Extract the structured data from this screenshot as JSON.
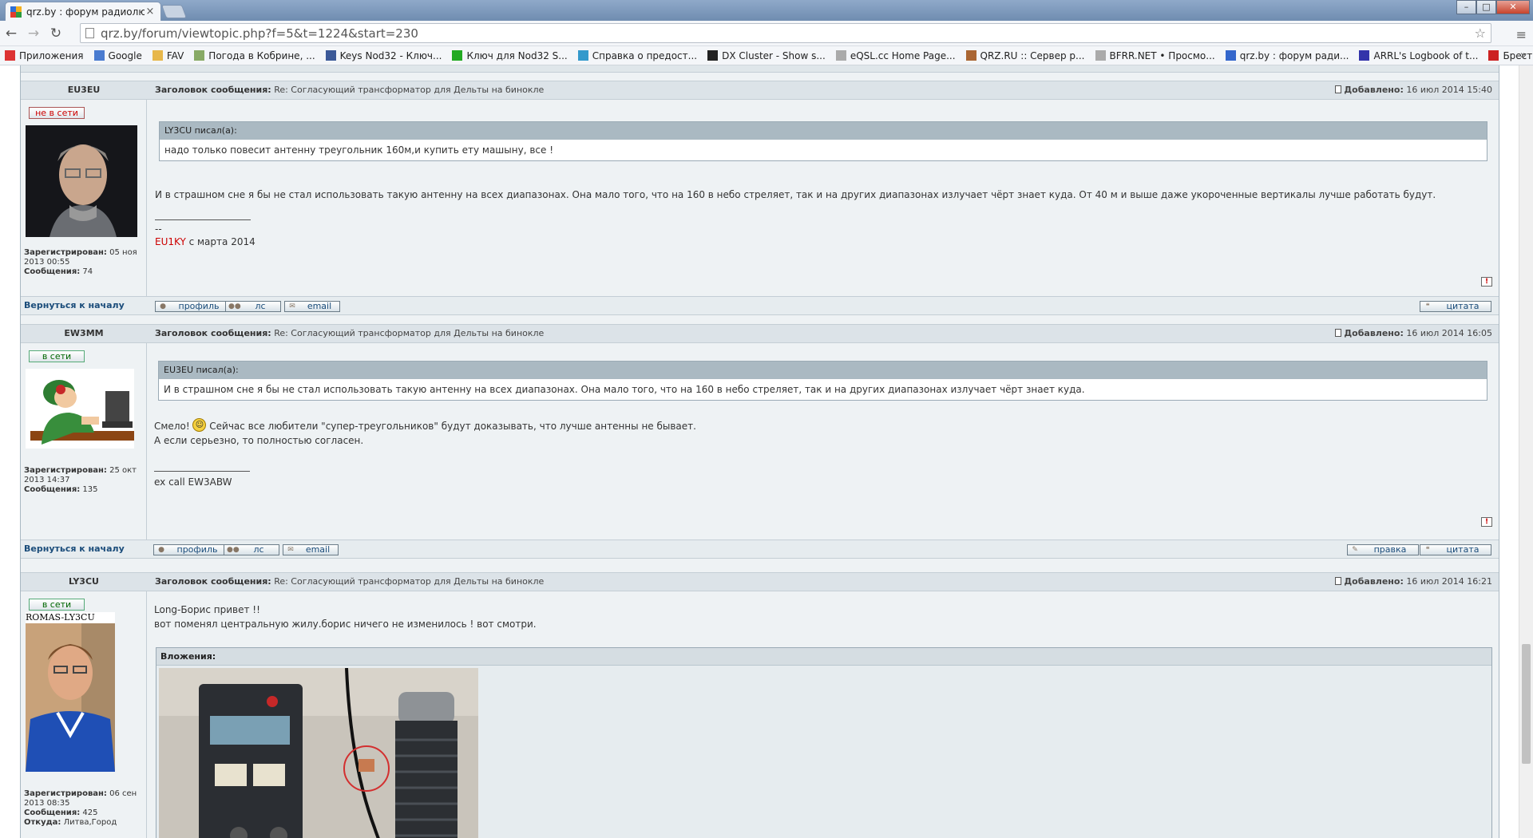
{
  "browser": {
    "tab_title": "qrz.by : форум радиолюб",
    "tab_close": "×",
    "url": "qrz.by/forum/viewtopic.php?f=5&t=1224&start=230",
    "back": "←",
    "forward": "→",
    "reload": "↻",
    "star": "☆",
    "menu": "≡",
    "win_min": "–",
    "win_max": "□",
    "win_close": "✕"
  },
  "bookmarks": [
    {
      "label": "Приложения",
      "icon": "apps-icon",
      "color": "#d33"
    },
    {
      "label": "Google",
      "icon": "google-icon",
      "color": "#4a7bd0"
    },
    {
      "label": "FAV",
      "icon": "folder-icon",
      "color": "#e7b74a"
    },
    {
      "label": "Погода в Кобрине, ...",
      "icon": "weather-icon",
      "color": "#8a6"
    },
    {
      "label": "Keys Nod32 - Ключ...",
      "icon": "facebook-icon",
      "color": "#3b5998"
    },
    {
      "label": "Ключ для Nod32 S...",
      "icon": "key-icon",
      "color": "#2a2"
    },
    {
      "label": "Справка о предост...",
      "icon": "help-icon",
      "color": "#39c"
    },
    {
      "label": "DX Cluster - Show s...",
      "icon": "aw-icon",
      "color": "#222"
    },
    {
      "label": "eQSL.cc Home Page...",
      "icon": "page-icon",
      "color": "#aaa"
    },
    {
      "label": "QRZ.RU :: Сервер р...",
      "icon": "qrz-icon",
      "color": "#a63"
    },
    {
      "label": "BFRR.NET • Просмо...",
      "icon": "page-icon",
      "color": "#aaa"
    },
    {
      "label": "qrz.by : форум ради...",
      "icon": "qrzby-icon",
      "color": "#36c"
    },
    {
      "label": "ARRL's Logbook of t...",
      "icon": "arrl-icon",
      "color": "#33a"
    },
    {
      "label": "Брест : Web-камер...",
      "icon": "vb-icon",
      "color": "#c22"
    }
  ],
  "bookmarks_more": "»",
  "forum": {
    "subject_label": "Заголовок сообщения:",
    "posted_label": "Добавлено:",
    "back_to_top": "Вернуться к началу",
    "registered_label": "Зарегистрирован:",
    "posts_label": "Сообщения:",
    "profile": "профиль",
    "pm": "лс",
    "email": "email",
    "quote": "цитата",
    "edit": "правка",
    "report": "!"
  },
  "posts": [
    {
      "author": "EU3EU",
      "status": "не в сети",
      "subject": "Re: Согласующий трансформатор для Дельты на биноклe",
      "date": "16 июл 2014 15:40",
      "registered": "05 ноя 2013 00:55",
      "posts": "74",
      "quote_author": "LY3CU писал(а):",
      "quote_text": "надо только повесит антенну треугольник 160м,и купить ету машыну, все !",
      "text": "И в страшном сне я бы не стал использовать такую антенну на всех диапазонах. Она мало того, что на 160 в небо стреляет, так и на других диапазонах излучает чёрт знает куда. От 40 м и выше даже укороченные вертикалы лучше работать будут.",
      "sig_dash": "--",
      "sig_call": "EU1KY",
      "sig_rest": " с марта 2014"
    },
    {
      "author": "EW3MM",
      "status": "в сети",
      "subject": "Re: Согласующий трансформатор для Дельты на биноклe",
      "date": "16 июл 2014 16:05",
      "registered": "25 окт 2013 14:37",
      "posts": "135",
      "quote_author": "EU3EU писал(а):",
      "quote_text": "И в страшном сне я бы не стал использовать такую антенну на всех диапазонах. Она мало того, что на 160 в небо стреляет, так и на других диапазонах излучает чёрт знает куда.",
      "text1_a": "Смело! ",
      "text1_b": " Сейчас все любители \"супер-треугольников\" будут доказывать, что лучше антенны не бывает.",
      "text2": "А если серьезно, то полностью согласен.",
      "sig": "ex call EW3ABW"
    },
    {
      "author": "LY3CU",
      "status": "в сети",
      "subject": "Re: Согласующий трансформатор для Дельты на биноклe",
      "date": "16 июл 2014 16:21",
      "registered": "06 сен 2013 08:35",
      "posts": "425",
      "from_label": "Откуда:",
      "from": "Литва,Город",
      "avatar_caption": "ROMAS-LY3CU",
      "text1": "Long-Борис привет !!",
      "text2": "вот поменял центральную жилу.борис ничего не изменилось ! вот смотри.",
      "attachments_label": "Вложения:"
    }
  ]
}
